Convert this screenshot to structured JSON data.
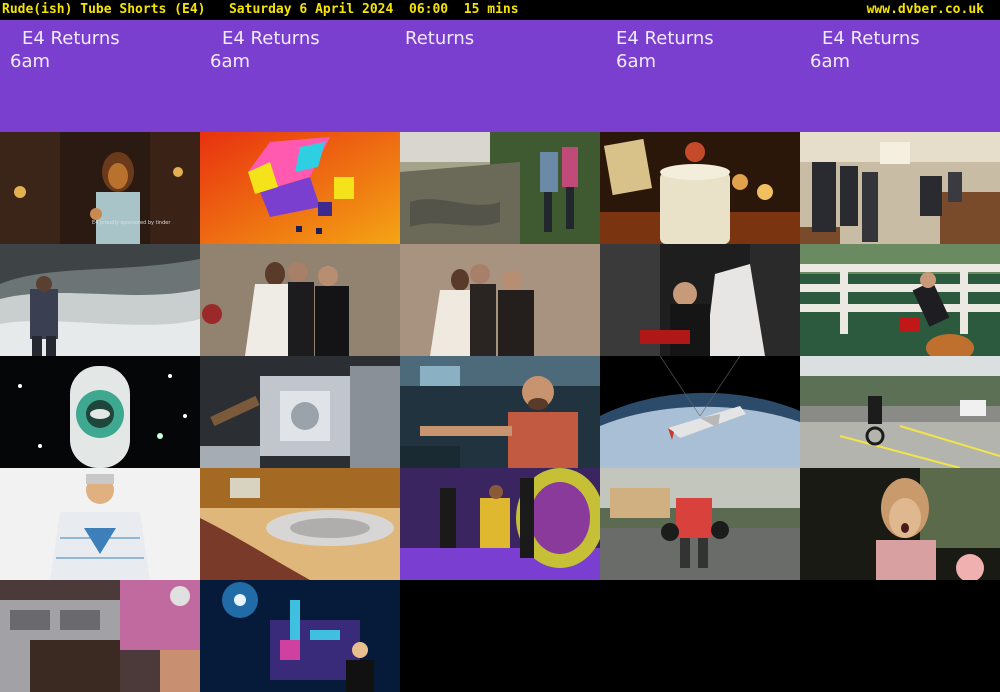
{
  "header": {
    "left_text": "Rude(ish) Tube Shorts (E4)   Saturday 6 April 2024  06:00  15 mins",
    "site": "www.dvber.co.uk"
  },
  "title_cards": [
    {
      "line1": "E4 Returns",
      "line2": "6am"
    },
    {
      "line1": "E4 Returns",
      "line2": "6am"
    },
    {
      "line1": "Returns",
      "line2": ""
    },
    {
      "line1": "E4 Returns",
      "line2": "6am"
    },
    {
      "line1": "E4 Returns",
      "line2": "6am"
    }
  ],
  "sponsor_text": "E4 proudly sponsored by tinder",
  "thumbnails": [
    {
      "name": "dancer-thumbnail",
      "colors": [
        "#2a1a12",
        "#b9722e"
      ]
    },
    {
      "name": "e4-logo-thumbnail",
      "colors": [
        "#e8310f",
        "#f4a514"
      ]
    },
    {
      "name": "muddy-hikers-thumbnail",
      "colors": [
        "#6b6a58",
        "#a5a38a"
      ]
    },
    {
      "name": "wedding-cake-thumbnail",
      "colors": [
        "#2b160a",
        "#e9d9a8"
      ]
    },
    {
      "name": "church-aisle-thumbnail",
      "colors": [
        "#3b3328",
        "#c9bca5"
      ]
    },
    {
      "name": "stormy-sea-thumbnail",
      "colors": [
        "#3e4446",
        "#c9cfcf"
      ]
    },
    {
      "name": "wedding-couple-thumbnail",
      "colors": [
        "#5a4b3c",
        "#b8a994"
      ]
    },
    {
      "name": "wedding-couple-2-thumbnail",
      "colors": [
        "#6e5a48",
        "#c6b39e"
      ]
    },
    {
      "name": "wedding-kiss-thumbnail",
      "colors": [
        "#1e1e1e",
        "#d8d6d4"
      ]
    },
    {
      "name": "fence-jump-thumbnail",
      "colors": [
        "#2c5a3f",
        "#ece9e2"
      ]
    },
    {
      "name": "rocket-toy-thumbnail",
      "colors": [
        "#050608",
        "#e3e7e6"
      ]
    },
    {
      "name": "space-station-thumbnail",
      "colors": [
        "#2b2e33",
        "#c1c6cc"
      ]
    },
    {
      "name": "astronaut-guitar-thumbnail",
      "colors": [
        "#20333f",
        "#c25a42"
      ]
    },
    {
      "name": "space-shuttle-thumbnail",
      "colors": [
        "#000000",
        "#a8bfd5"
      ]
    },
    {
      "name": "unicycle-thumbnail",
      "colors": [
        "#5b7055",
        "#b3b4ae"
      ]
    },
    {
      "name": "costume-man-thumbnail",
      "colors": [
        "#f2f2f2",
        "#3d7fb8"
      ]
    },
    {
      "name": "record-player-thumbnail",
      "colors": [
        "#a46a24",
        "#e0b77a"
      ]
    },
    {
      "name": "purple-stage-thumbnail",
      "colors": [
        "#3a2560",
        "#c6c037"
      ]
    },
    {
      "name": "robot-car-thumbnail",
      "colors": [
        "#5c6a52",
        "#d8413c"
      ]
    },
    {
      "name": "surprised-woman-thumbnail",
      "colors": [
        "#1a1a14",
        "#c89a6c"
      ]
    },
    {
      "name": "fryer-thumbnail",
      "colors": [
        "#4c3a3a",
        "#a2a1a6"
      ]
    },
    {
      "name": "signing-stage-thumbnail",
      "colors": [
        "#061a3a",
        "#2e8fd6"
      ]
    }
  ]
}
